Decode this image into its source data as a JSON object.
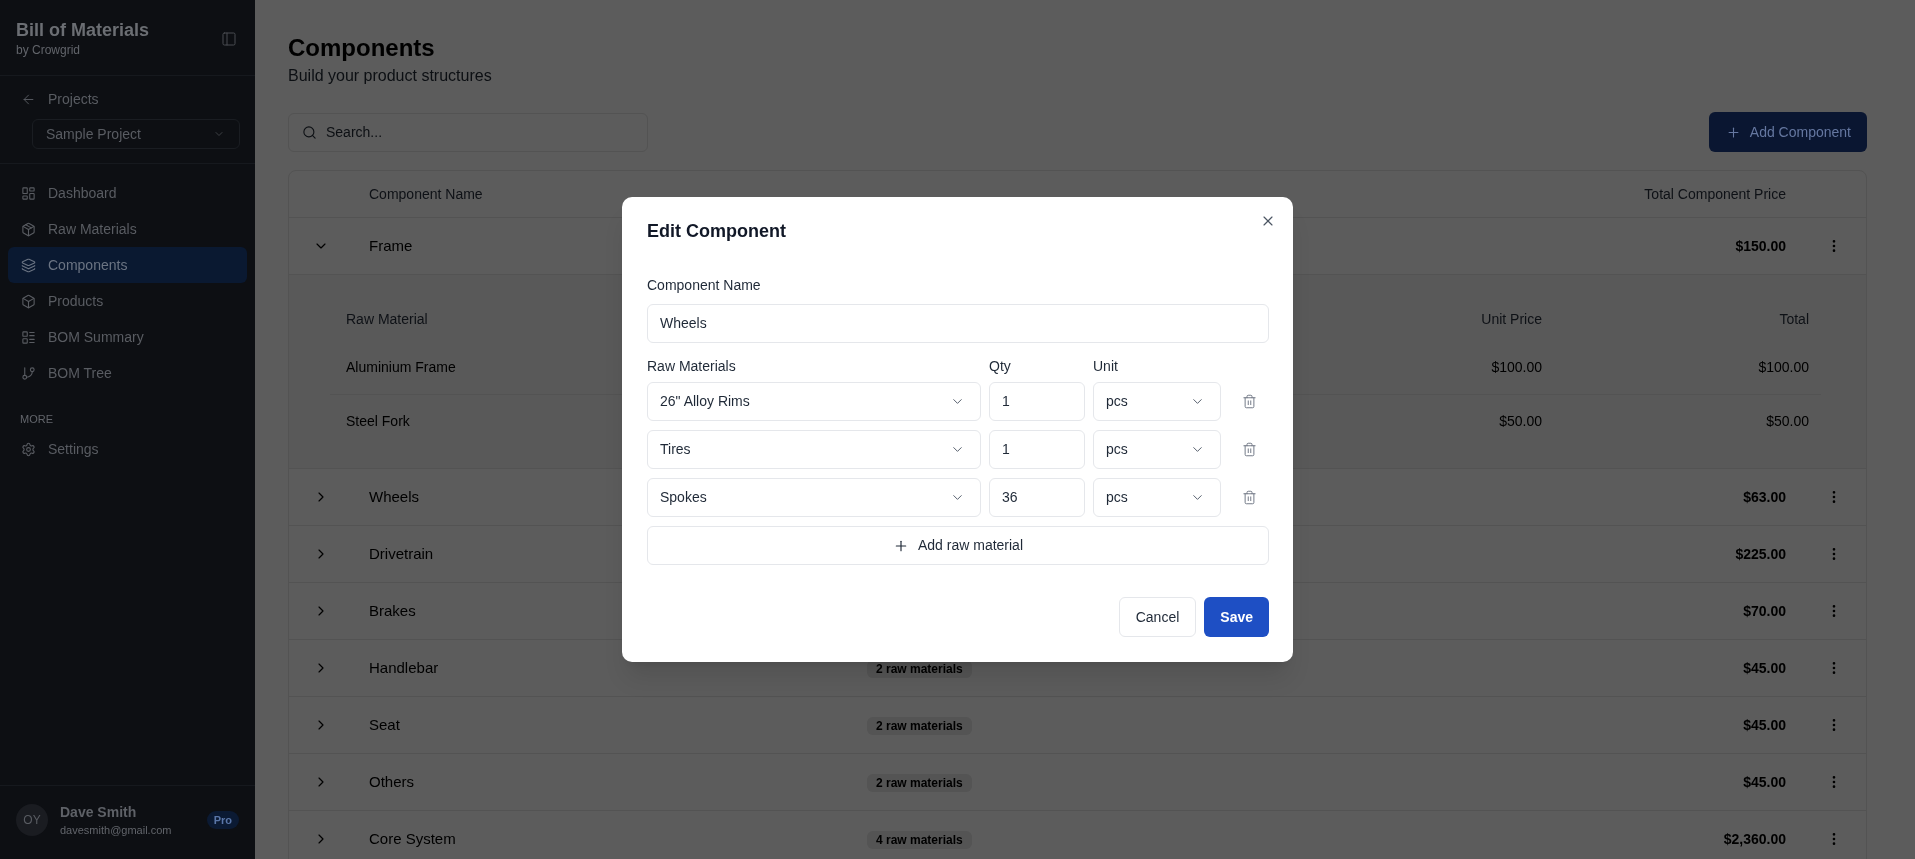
{
  "sidebar": {
    "title": "Bill of Materials",
    "subtitle": "by Crowgrid",
    "back_link": "Projects",
    "project_select": {
      "value": "Sample Project"
    },
    "nav_items": [
      {
        "label": "Dashboard",
        "selected": false
      },
      {
        "label": "Raw Materials",
        "selected": false
      },
      {
        "label": "Components",
        "selected": true
      },
      {
        "label": "Products",
        "selected": false
      },
      {
        "label": "BOM Summary",
        "selected": false
      },
      {
        "label": "BOM Tree",
        "selected": false
      }
    ],
    "section_label": "MORE",
    "more_items": [
      {
        "label": "Settings",
        "selected": false
      }
    ],
    "user": {
      "initials": "OY",
      "name": "Dave Smith",
      "email": "davesmith@gmail.com",
      "badge": "Pro"
    }
  },
  "page": {
    "title": "Components",
    "subtitle": "Build your product structures",
    "search": {
      "placeholder": "Search..."
    },
    "add_button": "Add Component"
  },
  "table": {
    "columns": [
      {
        "label": "Component Name",
        "kind": "name"
      },
      {
        "label": "Total Component Price",
        "kind": "total"
      }
    ],
    "rows": [
      {
        "name": "Frame",
        "expanded": true,
        "total": "$150.00",
        "details": {
          "columns": [
            "Raw Material",
            "Unit Price",
            "Total"
          ],
          "rows": [
            {
              "name": "Aluminium Frame",
              "unit_price": "$100.00",
              "total": "$100.00"
            },
            {
              "name": "Steel Fork",
              "unit_price": "$50.00",
              "total": "$50.00"
            }
          ]
        }
      },
      {
        "name": "Wheels",
        "expanded": false,
        "total": "$63.00"
      },
      {
        "name": "Drivetrain",
        "expanded": false,
        "total": "$225.00"
      },
      {
        "name": "Brakes",
        "expanded": false,
        "total": "$70.00"
      },
      {
        "name": "Handlebar",
        "expanded": false,
        "raw_materials": "2 raw materials",
        "total": "$45.00"
      },
      {
        "name": "Seat",
        "expanded": false,
        "raw_materials": "2 raw materials",
        "total": "$45.00"
      },
      {
        "name": "Others",
        "expanded": false,
        "raw_materials": "2 raw materials",
        "total": "$45.00"
      },
      {
        "name": "Core System",
        "expanded": false,
        "raw_materials": "4 raw materials",
        "total": "$2,360.00"
      }
    ]
  },
  "dialog": {
    "title": "Edit Component",
    "name_label": "Component Name",
    "name_value": "Wheels",
    "materials_label": "Raw Materials",
    "qty_label": "Qty",
    "unit_label": "Unit",
    "materials": [
      {
        "material": "26\" Alloy Rims",
        "qty": "1",
        "unit": "pcs"
      },
      {
        "material": "Tires",
        "qty": "1",
        "unit": "pcs"
      },
      {
        "material": "Spokes",
        "qty": "36",
        "unit": "pcs"
      }
    ],
    "add_button": "Add raw material",
    "buttons": [
      {
        "label": "Cancel",
        "kind": "secondary"
      },
      {
        "label": "Save",
        "kind": "primary"
      }
    ]
  }
}
